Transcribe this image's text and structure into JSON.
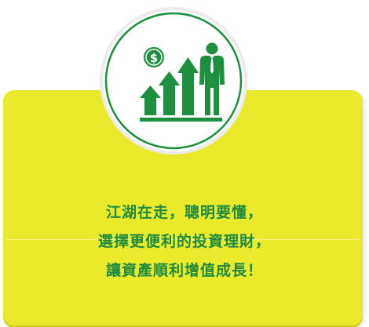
{
  "colors": {
    "background": "#ffffff",
    "panel": "#e9ea2c",
    "accent_green": "#1e8f3f",
    "ring": "#1e8f3f"
  },
  "icons": {
    "emblem": "finance-growth-businessman-icon",
    "coin": "dollar-coin-icon"
  },
  "caption": {
    "line1": "江湖在走，聰明要懂，",
    "line2": "選擇更便利的投資理財，",
    "line3": "讓資產順利增值成長！"
  }
}
